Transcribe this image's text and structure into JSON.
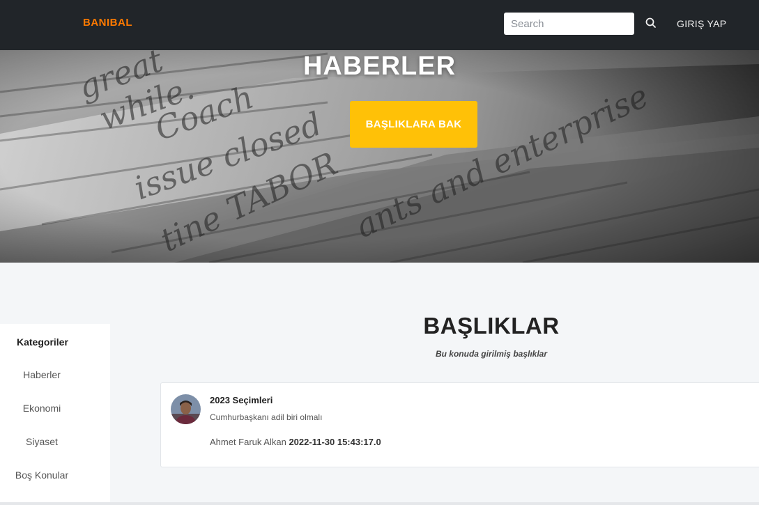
{
  "navbar": {
    "brand": "BANIBAL",
    "search_placeholder": "Search",
    "search_icon": "search-icon",
    "login_label": "GIRIŞ YAP"
  },
  "hero": {
    "title": "HABERLER",
    "button_label": "BAŞLIKLARA BAK"
  },
  "sidebar": {
    "title": "Kategoriler",
    "items": [
      {
        "label": "Haberler"
      },
      {
        "label": "Ekonomi"
      },
      {
        "label": "Siyaset"
      },
      {
        "label": "Boş Konular"
      }
    ]
  },
  "main": {
    "title": "BAŞLIKLAR",
    "subtitle": "Bu konuda girilmiş başlıklar",
    "topics": [
      {
        "title": "2023 Seçimleri",
        "body": "Cumhurbaşkanı adil biri olmalı",
        "author": "Ahmet Faruk Alkan",
        "date": "2022-11-30 15:43:17.0"
      }
    ]
  },
  "colors": {
    "navbar_bg": "#212529",
    "brand": "#ff7a00",
    "hero_button": "#ffc107",
    "page_bg": "#f4f6f8"
  }
}
